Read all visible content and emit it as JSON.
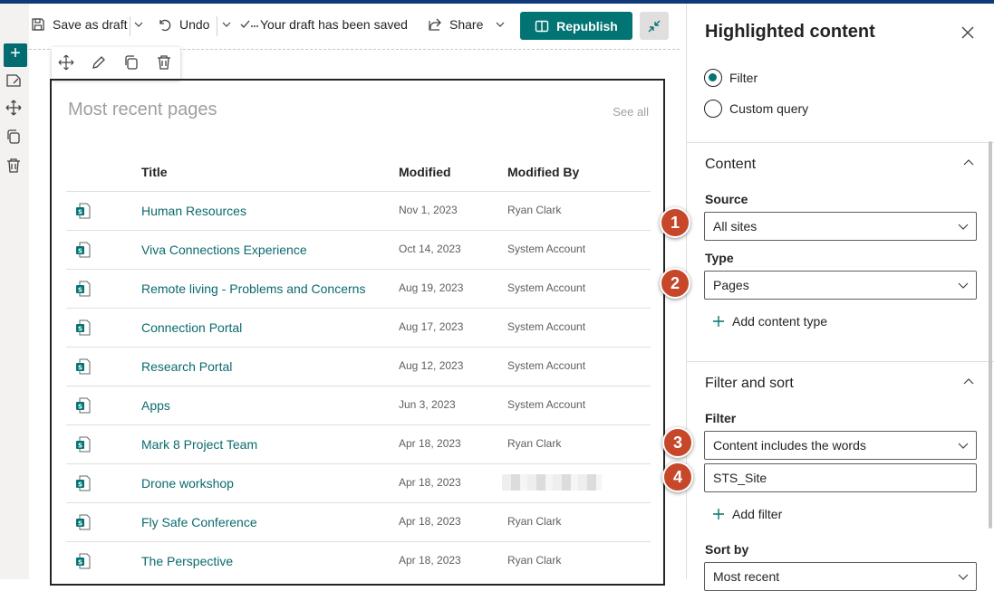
{
  "toolbar": {
    "save_label": "Save as draft",
    "undo_label": "Undo",
    "status_label": "Your draft has been saved",
    "share_label": "Share",
    "republish_label": "Republish"
  },
  "webpart": {
    "title": "Most recent pages",
    "see_all": "See all",
    "columns": {
      "title": "Title",
      "modified": "Modified",
      "modified_by": "Modified By"
    },
    "rows": [
      {
        "title": "Human Resources",
        "modified": "Nov 1, 2023",
        "modified_by": "Ryan Clark"
      },
      {
        "title": "Viva Connections Experience",
        "modified": "Oct 14, 2023",
        "modified_by": "System Account"
      },
      {
        "title": "Remote living - Problems and Concerns",
        "modified": "Aug 19, 2023",
        "modified_by": "System Account"
      },
      {
        "title": "Connection Portal",
        "modified": "Aug 17, 2023",
        "modified_by": "System Account"
      },
      {
        "title": "Research Portal",
        "modified": "Aug 12, 2023",
        "modified_by": "System Account"
      },
      {
        "title": "Apps",
        "modified": "Jun 3, 2023",
        "modified_by": "System Account"
      },
      {
        "title": "Mark 8 Project Team",
        "modified": "Apr 18, 2023",
        "modified_by": "Ryan Clark"
      },
      {
        "title": "Drone workshop",
        "modified": "Apr 18, 2023",
        "modified_by": ""
      },
      {
        "title": "Fly Safe Conference",
        "modified": "Apr 18, 2023",
        "modified_by": "Ryan Clark"
      },
      {
        "title": "The Perspective",
        "modified": "Apr 18, 2023",
        "modified_by": "Ryan Clark"
      }
    ]
  },
  "pane": {
    "title": "Highlighted content",
    "radio_filter": "Filter",
    "radio_custom": "Custom query",
    "content_section": "Content",
    "source_label": "Source",
    "source_value": "All sites",
    "type_label": "Type",
    "type_value": "Pages",
    "add_content_type": "Add content type",
    "filter_sort_section": "Filter and sort",
    "filter_label": "Filter",
    "filter_value": "Content includes the words",
    "filter_text": "STS_Site",
    "add_filter": "Add filter",
    "sort_label": "Sort by",
    "sort_value": "Most recent"
  },
  "markers": [
    "1",
    "2",
    "3",
    "4"
  ],
  "colors": {
    "accent": "#037474",
    "marker": "#c6472a",
    "link": "#0b6a6e"
  }
}
